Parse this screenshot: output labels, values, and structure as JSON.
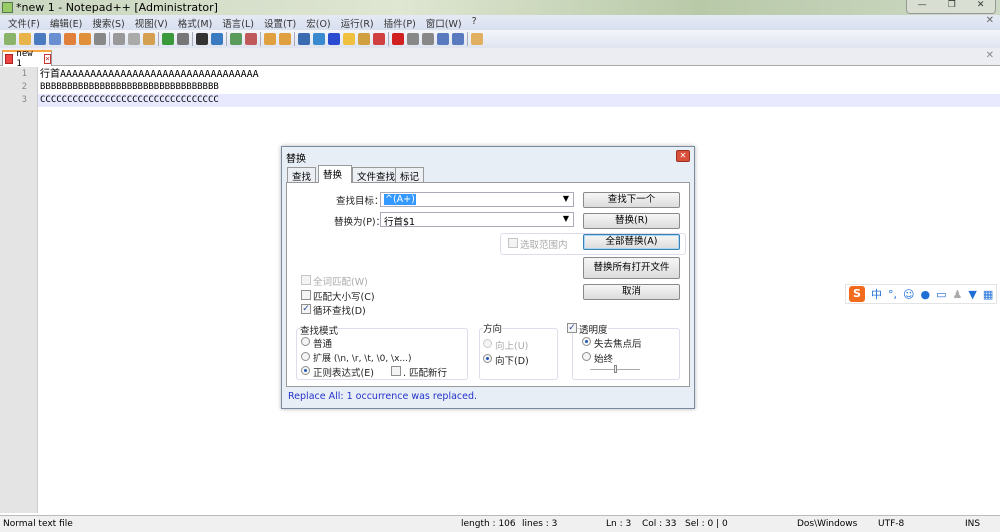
{
  "window": {
    "title": "*new 1 - Notepad++ [Administrator]",
    "min": "—",
    "max": "❐",
    "close": "✕"
  },
  "menu": [
    "文件(F)",
    "编辑(E)",
    "搜索(S)",
    "视图(V)",
    "格式(M)",
    "语言(L)",
    "设置(T)",
    "宏(O)",
    "运行(R)",
    "插件(P)",
    "窗口(W)",
    "?"
  ],
  "menu_close": "✕",
  "toolbar": [
    {
      "icon": "new-file-icon",
      "color": "#8ab46a"
    },
    {
      "icon": "open-file-icon",
      "color": "#e8b44a"
    },
    {
      "icon": "save-icon",
      "color": "#4a7ac0"
    },
    {
      "icon": "save-all-icon",
      "color": "#6a8fd0"
    },
    {
      "icon": "close-icon",
      "color": "#e0803a"
    },
    {
      "icon": "close-all-icon",
      "color": "#e0903a"
    },
    {
      "icon": "print-icon",
      "color": "#888"
    },
    "sep",
    {
      "icon": "cut-icon",
      "color": "#999"
    },
    {
      "icon": "copy-icon",
      "color": "#aaa"
    },
    {
      "icon": "paste-icon",
      "color": "#d4a050"
    },
    "sep",
    {
      "icon": "undo-icon",
      "color": "#3a9a3a"
    },
    {
      "icon": "redo-icon",
      "color": "#777"
    },
    "sep",
    {
      "icon": "find-icon",
      "color": "#333"
    },
    {
      "icon": "replace-icon",
      "color": "#3a7ac0"
    },
    "sep",
    {
      "icon": "zoom-in-icon",
      "color": "#5a9a5a"
    },
    {
      "icon": "zoom-out-icon",
      "color": "#c05a5a"
    },
    "sep",
    {
      "icon": "sync-vertical-icon",
      "color": "#e0a040"
    },
    {
      "icon": "sync-horizontal-icon",
      "color": "#e0a040"
    },
    "sep",
    {
      "icon": "word-wrap-icon",
      "color": "#3a6ab0"
    },
    {
      "icon": "show-all-chars-icon",
      "color": "#3a8ad0"
    },
    {
      "icon": "indent-guide-icon",
      "color": "#2a4ad0"
    },
    {
      "icon": "udl-icon",
      "color": "#f0c040"
    },
    {
      "icon": "doc-map-icon",
      "color": "#d0a040"
    },
    {
      "icon": "function-list-icon",
      "color": "#d04040"
    },
    "sep",
    {
      "icon": "record-macro-icon",
      "color": "#d02020"
    },
    {
      "icon": "stop-macro-icon",
      "color": "#888"
    },
    {
      "icon": "play-macro-icon",
      "color": "#888"
    },
    {
      "icon": "play-multiple-icon",
      "color": "#5a7ac0"
    },
    {
      "icon": "save-macro-icon",
      "color": "#5a7ac0"
    },
    "sep",
    {
      "icon": "launch-icon",
      "color": "#e0b060"
    }
  ],
  "tab": {
    "label": "new 1",
    "close": "✕"
  },
  "tabbar_close": "✕",
  "editor": {
    "lines": [
      {
        "num": "1",
        "text": "行首AAAAAAAAAAAAAAAAAAAAAAAAAAAAAAAAA"
      },
      {
        "num": "2",
        "text": "BBBBBBBBBBBBBBBBBBBBBBBBBBBBBBBBB"
      },
      {
        "num": "3",
        "text": "CCCCCCCCCCCCCCCCCCCCCCCCCCCCCCCCC"
      }
    ]
  },
  "status": {
    "file_type": "Normal text file",
    "length": "length : 106",
    "lines": "lines : 3",
    "ln": "Ln : 3",
    "col": "Col : 33",
    "sel": "Sel : 0 | 0",
    "eol": "Dos\\Windows",
    "encoding": "UTF-8",
    "mode": "INS"
  },
  "dialog": {
    "title": "替换",
    "close": "✕",
    "tabs": [
      "查找",
      "替换",
      "文件查找",
      "标记"
    ],
    "find_label": "查找目标：",
    "find_value": "^(A+)",
    "replace_label": "替换为(P)：",
    "replace_value": "行首$1",
    "in_selection": "选取范围内",
    "buttons": {
      "find_next": "查找下一个",
      "replace": "替换(R)",
      "replace_all": "全部替换(A)",
      "replace_all_open": "替换所有打开文件",
      "cancel": "取消"
    },
    "options": {
      "whole_word": "全词匹配(W)",
      "match_case": "匹配大小写(C)",
      "wrap_around": "循环查找(D)"
    },
    "search_mode": {
      "title": "查找模式",
      "normal": "普通",
      "extended": "扩展 (\\n, \\r, \\t, \\0, \\x...)",
      "regex": "正则表达式(E)",
      "dot_newline": ". 匹配新行"
    },
    "direction": {
      "title": "方向",
      "up": "向上(U)",
      "down": "向下(D)"
    },
    "transparency": {
      "title": "透明度",
      "on_lose_focus": "失去焦点后",
      "always": "始终",
      "level": 0.5
    },
    "status_message": "Replace All: 1 occurrence was replaced."
  },
  "ime": {
    "logo": "S",
    "lang": "中",
    "punct": "°,",
    "icons": [
      "emoji-icon",
      "microphone-icon",
      "keyboard-icon",
      "user-icon",
      "skin-icon",
      "toolbox-icon"
    ]
  }
}
